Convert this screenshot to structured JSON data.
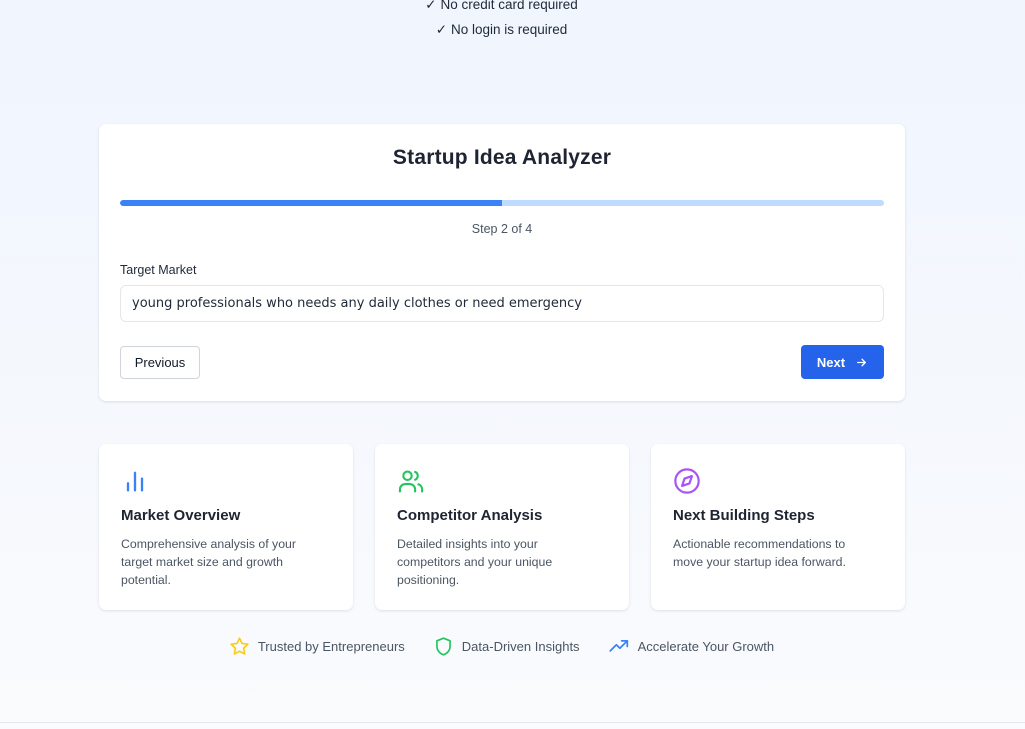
{
  "header": {
    "checks": [
      {
        "mark": "✓",
        "text": "No credit card required"
      },
      {
        "mark": "✓",
        "text": "No login is required"
      }
    ]
  },
  "analyzer": {
    "title": "Startup Idea Analyzer",
    "step_text": "Step 2 of 4",
    "progress_percent": 50,
    "field_label": "Target Market",
    "field_value": "young professionals who needs any daily clothes or need emergency",
    "previous_label": "Previous",
    "next_label": "Next",
    "accent_color": "#2563eb",
    "progress_color": "#3b82f6",
    "progress_track_color": "#bfdbfe"
  },
  "features": [
    {
      "icon": "bar-chart-icon",
      "title": "Market Overview",
      "desc": "Comprehensive analysis of your target market size and growth potential.",
      "color": "#3b82f6"
    },
    {
      "icon": "users-icon",
      "title": "Competitor Analysis",
      "desc": "Detailed insights into your competitors and your unique positioning.",
      "color": "#22c55e"
    },
    {
      "icon": "compass-icon",
      "title": "Next Building Steps",
      "desc": "Actionable recommendations to move your startup idea forward.",
      "color": "#a855f7"
    }
  ],
  "trust": [
    {
      "icon": "star-icon",
      "text": "Trusted by Entrepreneurs",
      "color": "#facc15"
    },
    {
      "icon": "shield-icon",
      "text": "Data-Driven Insights",
      "color": "#22c55e"
    },
    {
      "icon": "trending-up-icon",
      "text": "Accelerate Your Growth",
      "color": "#3b82f6"
    }
  ]
}
